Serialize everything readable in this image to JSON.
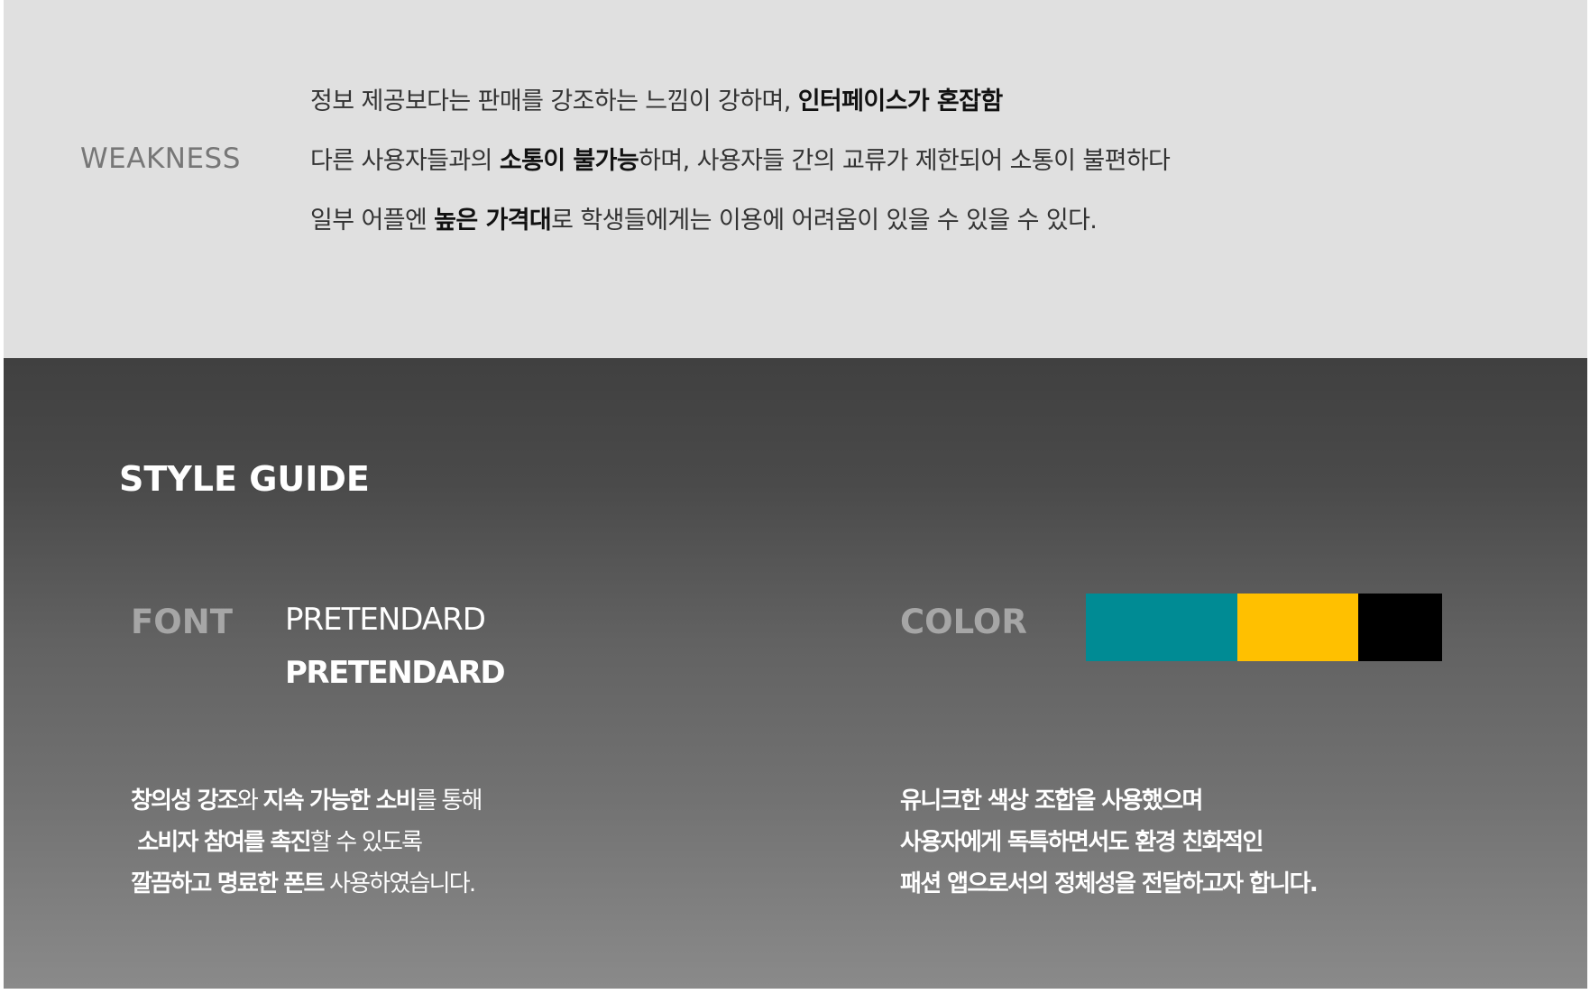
{
  "weakness": {
    "label": "WEAKNESS",
    "items": [
      {
        "pre": "정보 제공보다는 판매를 강조하는 느낌이 강하며, ",
        "bold": "인터페이스가 혼잡함",
        "post": ""
      },
      {
        "pre": "다른 사용자들과의 ",
        "bold": "소통이 불가능",
        "post": "하며, 사용자들 간의 교류가 제한되어 소통이 불편하다"
      },
      {
        "pre": "일부 어플엔 ",
        "bold": "높은 가격대",
        "post": "로 학생들에게는 이용에 어려움이 있을 수 있을 수 있다."
      }
    ]
  },
  "style_guide": {
    "title": "STYLE GUIDE",
    "font": {
      "label": "FONT",
      "sample_regular": "PRETENDARD",
      "sample_bold": "PRETENDARD",
      "description": [
        [
          {
            "text": "창의성 강조",
            "bold": true
          },
          {
            "text": "와 ",
            "bold": false
          },
          {
            "text": "지속 가능한 소비",
            "bold": true
          },
          {
            "text": "를 통해",
            "bold": false
          }
        ],
        [
          {
            "text": " 소비자 참여를 촉진",
            "bold": true
          },
          {
            "text": "할 수 있도록",
            "bold": false
          }
        ],
        [
          {
            "text": "깔끔하고 명료한 폰트",
            "bold": true
          },
          {
            "text": " 사용하였습니다.",
            "bold": false
          }
        ]
      ]
    },
    "color": {
      "label": "COLOR",
      "swatches": [
        "#008b94",
        "#ffc000",
        "#000000"
      ],
      "description": [
        "유니크한 색상 조합을 사용했으며",
        "사용자에게 독특하면서도 환경 친화적인",
        "패션 앱으로서의 정체성을 전달하고자 합니다."
      ]
    }
  }
}
